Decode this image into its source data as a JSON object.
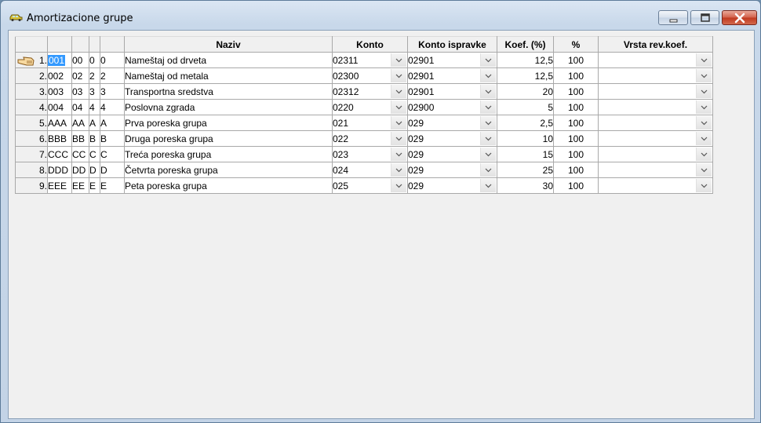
{
  "window": {
    "title": "Amortizacione grupe",
    "icon": "car-icon",
    "buttons": [
      "minimize-icon",
      "maximize-icon",
      "close-icon"
    ]
  },
  "grid": {
    "headers": {
      "c1": "",
      "c2": "",
      "c3": "",
      "c4": "",
      "naziv": "Naziv",
      "konto": "Konto",
      "konto_ispravke": "Konto ispravke",
      "koef": "Koef. (%)",
      "pct": "%",
      "vrsta": "Vrsta rev.koef."
    },
    "current_row_icon": "hand-pointer-icon",
    "rows": [
      {
        "n": "1.",
        "c1": "001",
        "c2": "00",
        "c3": "0",
        "c4": "0",
        "naziv": "Nameštaj od drveta",
        "konto": "02311",
        "konto_isp": "02901",
        "koef": "12,5",
        "pct": "100",
        "vrsta": ""
      },
      {
        "n": "2.",
        "c1": "002",
        "c2": "02",
        "c3": "2",
        "c4": "2",
        "naziv": "Nameštaj od metala",
        "konto": "02300",
        "konto_isp": "02901",
        "koef": "12,5",
        "pct": "100",
        "vrsta": ""
      },
      {
        "n": "3.",
        "c1": "003",
        "c2": "03",
        "c3": "3",
        "c4": "3",
        "naziv": "Transportna sredstva",
        "konto": "02312",
        "konto_isp": "02901",
        "koef": "20",
        "pct": "100",
        "vrsta": ""
      },
      {
        "n": "4.",
        "c1": "004",
        "c2": "04",
        "c3": "4",
        "c4": "4",
        "naziv": "Poslovna zgrada",
        "konto": "0220",
        "konto_isp": "02900",
        "koef": "5",
        "pct": "100",
        "vrsta": ""
      },
      {
        "n": "5.",
        "c1": "AAA",
        "c2": "AA",
        "c3": "A",
        "c4": "A",
        "naziv": "Prva poreska grupa",
        "konto": "021",
        "konto_isp": "029",
        "koef": "2,5",
        "pct": "100",
        "vrsta": ""
      },
      {
        "n": "6.",
        "c1": "BBB",
        "c2": "BB",
        "c3": "B",
        "c4": "B",
        "naziv": "Druga poreska grupa",
        "konto": "022",
        "konto_isp": "029",
        "koef": "10",
        "pct": "100",
        "vrsta": ""
      },
      {
        "n": "7.",
        "c1": "CCC",
        "c2": "CC",
        "c3": "C",
        "c4": "C",
        "naziv": "Treća poreska grupa",
        "konto": "023",
        "konto_isp": "029",
        "koef": "15",
        "pct": "100",
        "vrsta": ""
      },
      {
        "n": "8.",
        "c1": "DDD",
        "c2": "DD",
        "c3": "D",
        "c4": "D",
        "naziv": "Četvrta poreska grupa",
        "konto": "024",
        "konto_isp": "029",
        "koef": "25",
        "pct": "100",
        "vrsta": ""
      },
      {
        "n": "9.",
        "c1": "EEE",
        "c2": "EE",
        "c3": "E",
        "c4": "E",
        "naziv": "Peta poreska grupa",
        "konto": "025",
        "konto_isp": "029",
        "koef": "30",
        "pct": "100",
        "vrsta": ""
      }
    ]
  }
}
